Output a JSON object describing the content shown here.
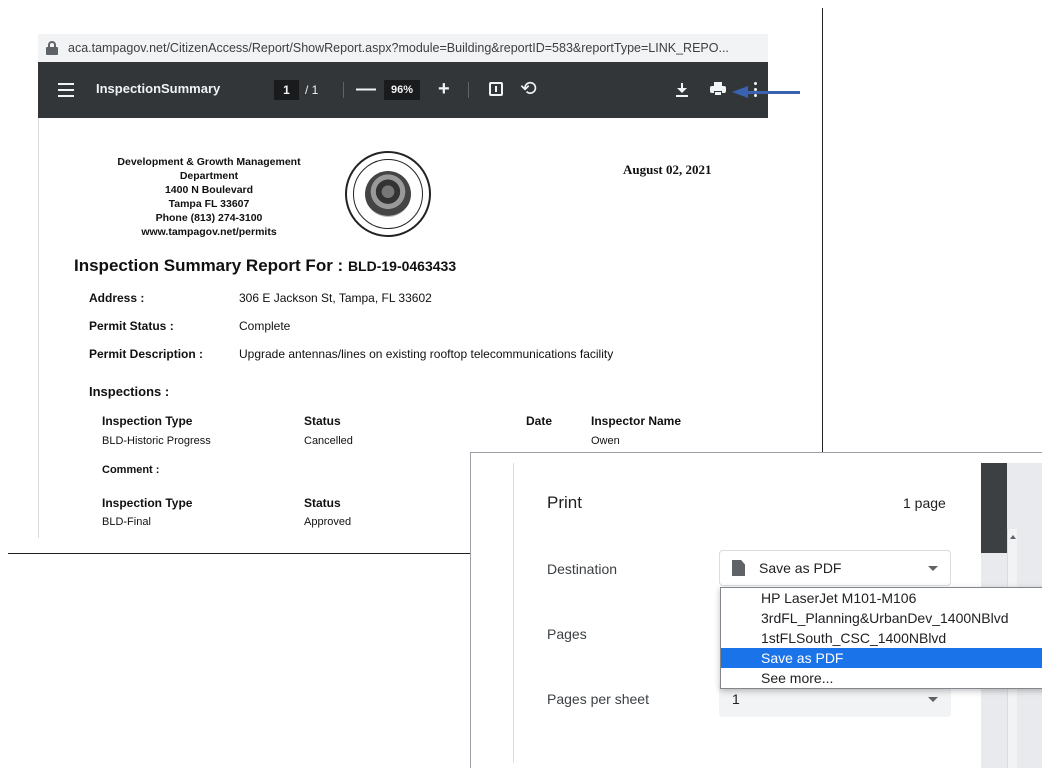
{
  "pdf_viewer": {
    "url": "aca.tampagov.net/CitizenAccess/Report/ShowReport.aspx?module=Building&reportID=583&reportType=LINK_REPO...",
    "toolbar": {
      "title": "InspectionSummary",
      "page_current": "1",
      "page_total": "/ 1",
      "zoom_out": "—",
      "zoom": "96%",
      "zoom_in": "+",
      "rotate_glyph": "⟲"
    },
    "report": {
      "org_lines": [
        "Development & Growth Management",
        "Department",
        "1400 N Boulevard",
        "Tampa FL 33607",
        "Phone (813) 274-3100",
        "www.tampagov.net/permits"
      ],
      "date": "August 02, 2021",
      "title_prefix": "Inspection Summary Report For : ",
      "permit_number": "BLD-19-0463433",
      "address_label": "Address :",
      "address_value": "306 E Jackson St, Tampa, FL  33602",
      "status_label": "Permit Status :",
      "status_value": "Complete",
      "description_label": "Permit Description :",
      "description_value": "Upgrade antennas/lines on existing rooftop telecommunications facility",
      "inspections_heading": "Inspections :",
      "headers": {
        "type": "Inspection Type",
        "status": "Status",
        "date": "Date",
        "inspector": "Inspector Name"
      },
      "rows": [
        {
          "type": "BLD-Historic Progress",
          "status": "Cancelled",
          "inspector": "Owen",
          "comment_label": "Comment :"
        },
        {
          "type": "BLD-Final",
          "status": "Approved"
        }
      ]
    }
  },
  "print_dialog": {
    "title": "Print",
    "page_count": "1 page",
    "destination_label": "Destination",
    "destination_value": "Save as PDF",
    "pages_label": "Pages",
    "pages_per_sheet_label": "Pages per sheet",
    "pages_per_sheet_value": "1",
    "destination_options": [
      "HP LaserJet M101-M106",
      "3rdFL_Planning&UrbanDev_1400NBlvd",
      "1stFLSouth_CSC_1400NBlvd",
      "Save as PDF",
      "See more..."
    ],
    "selected_option_index": 3
  },
  "colors": {
    "toolbar_bg": "#323639",
    "arrow": "#3a62b0",
    "selected": "#1a73e8"
  }
}
